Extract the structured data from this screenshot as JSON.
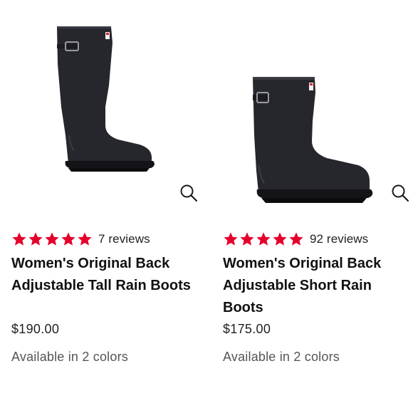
{
  "colors": {
    "star": "#e4002b",
    "boot": "#23232a",
    "text": "#111111",
    "muted": "#555555"
  },
  "products": [
    {
      "image_icon": "tall-rain-boot-image",
      "zoom_icon": "magnifier-icon",
      "rating": 5,
      "reviews": "7 reviews",
      "title": "Women's Original Back Adjustable Tall Rain Boots",
      "price": "$190.00",
      "colors_text": "Available in 2 colors"
    },
    {
      "image_icon": "short-rain-boot-image",
      "zoom_icon": "magnifier-icon",
      "rating": 5,
      "reviews": "92 reviews",
      "title": "Women's Original Back Adjustable Short Rain Boots",
      "price": "$175.00",
      "colors_text": "Available in 2 colors"
    }
  ]
}
